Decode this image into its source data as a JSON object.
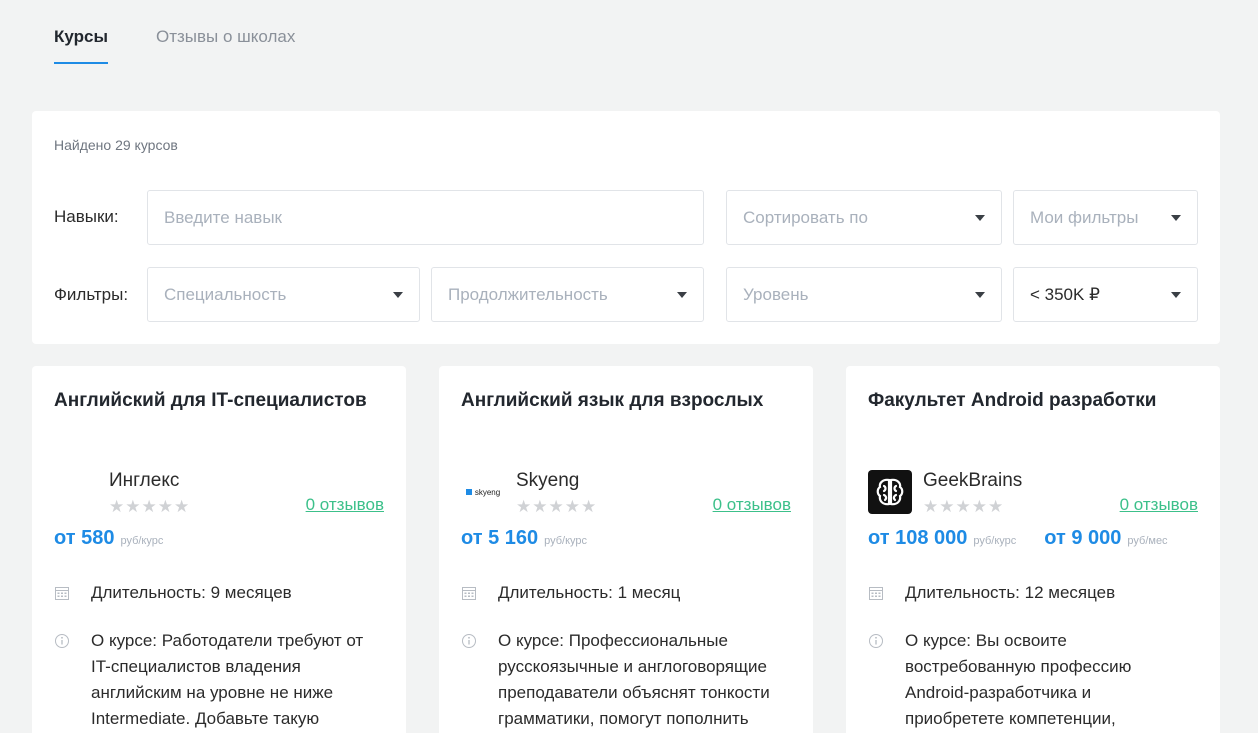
{
  "tabs": [
    {
      "label": "Курсы",
      "active": true
    },
    {
      "label": "Отзывы о школах",
      "active": false
    }
  ],
  "filters": {
    "found_text": "Найдено 29 курсов",
    "skills_label": "Навыки:",
    "skills_placeholder": "Введите навык",
    "sort_placeholder": "Сортировать по",
    "my_filters": "Мои фильтры",
    "filters_label": "Фильтры:",
    "specialty": "Специальность",
    "duration": "Продолжительность",
    "level": "Уровень",
    "price": "< 350K ₽"
  },
  "courses": [
    {
      "title": "Английский для IT-специалистов",
      "school": "Инглекс",
      "stars": "★★★★★",
      "reviews": "0 отзывов",
      "price1": "от 580",
      "unit1": "руб/курс",
      "duration": "Длительность: 9 месяцев",
      "about": [
        "О курсе: Работодатели требуют от",
        "IT-специалистов владения",
        "английским на уровне не ниже",
        "Intermediate. Добавьте такую"
      ]
    },
    {
      "title": "Английский язык для взрослых",
      "school": "Skyeng",
      "logo_text": "skyeng",
      "stars": "★★★★★",
      "reviews": "0 отзывов",
      "price1": "от 5 160",
      "unit1": "руб/курс",
      "duration": "Длительность: 1 месяц",
      "about": [
        "О курсе: Профессиональные",
        "русскоязычные и англоговорящие",
        "преподаватели объяснят тонкости",
        "грамматики, помогут пополнить"
      ]
    },
    {
      "title": "Факультет Android разработки",
      "school": "GeekBrains",
      "stars": "★★★★★",
      "reviews": "0 отзывов",
      "price1": "от 108 000",
      "unit1": "руб/курс",
      "price2": "от 9 000",
      "unit2": "руб/мес",
      "duration": "Длительность: 12 месяцев",
      "about": [
        "О курсе: Вы освоите",
        "востребованную профессию",
        "Android-разработчика и",
        "приобретете компетенции,"
      ]
    }
  ],
  "colors": {
    "accent": "#1e8be5",
    "reviews": "#3cc08a"
  }
}
